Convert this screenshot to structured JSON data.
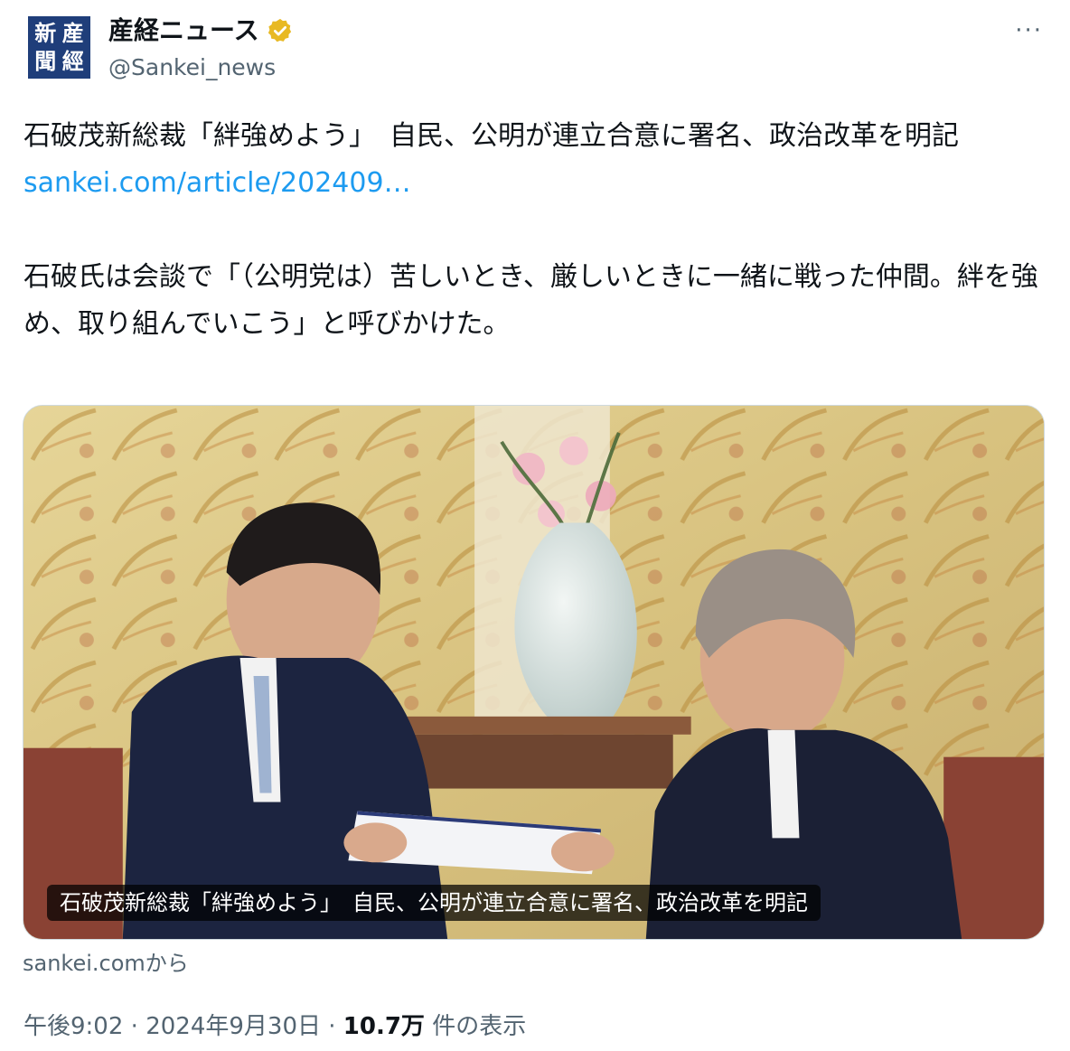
{
  "author": {
    "avatar_glyphs": [
      "産",
      "新",
      "經",
      "聞"
    ],
    "display_name": "産経ニュース",
    "handle": "@Sankei_news",
    "verified_color": "#e8b923"
  },
  "more_label": "···",
  "tweet": {
    "headline": "石破茂新総裁「絆強めよう」　自民、公明が連立合意に署名、政治改革を明記",
    "link_text": "sankei.com/article/202409…",
    "body": "石破氏は会談で「（公明党は）苦しいとき、厳しいときに一緒に戦った仲間。絆を強め、取り組んでいこう」と呼びかけた。"
  },
  "card": {
    "title": "石破茂新総裁「絆強めよう」　自民、公明が連立合意に署名、政治改革を明記",
    "source": "sankei.comから"
  },
  "meta": {
    "time": "午後9:02",
    "separator": "·",
    "date": "2024年9月30日",
    "views_count": "10.7万",
    "views_label": "件の表示"
  },
  "colors": {
    "link": "#1d9bf0",
    "secondary_text": "#536471",
    "avatar_bg": "#1f3e7a"
  }
}
